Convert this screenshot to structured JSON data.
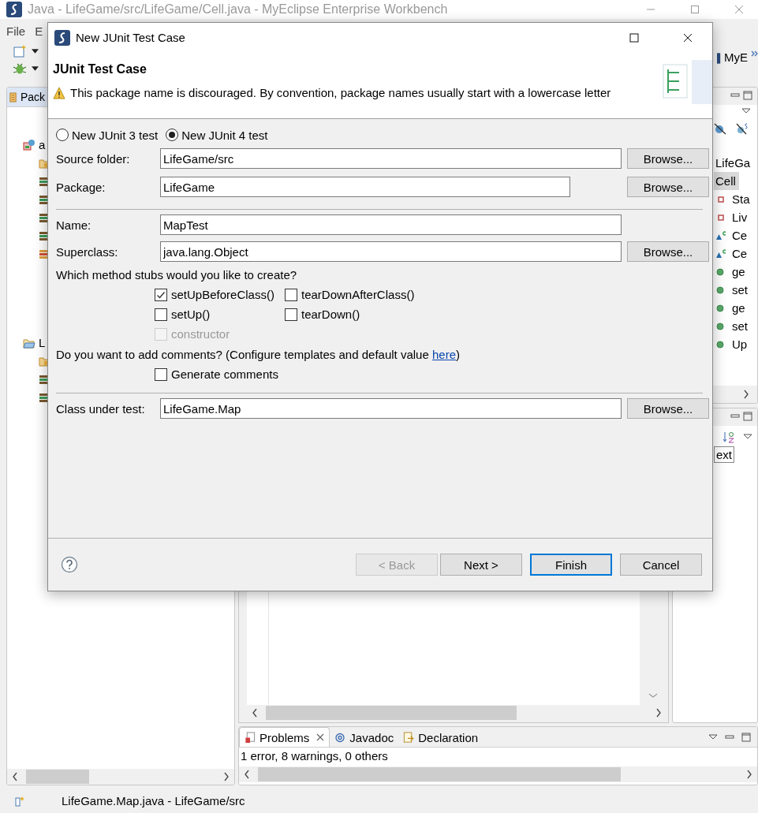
{
  "window": {
    "title": "Java - LifeGame/src/LifeGame/Cell.java - MyEclipse Enterprise Workbench"
  },
  "menu_bar": [
    {
      "label": "File"
    },
    {
      "label": "E"
    }
  ],
  "perspective": {
    "label": "MyE"
  },
  "package_explorer": {
    "tab": "Pack",
    "tree": [
      {
        "label": "a",
        "kind": "project",
        "children": [
          {
            "kind": "package"
          },
          {
            "kind": "library"
          },
          {
            "kind": "library"
          },
          {
            "kind": "library"
          },
          {
            "kind": "library"
          },
          {
            "kind": "error-library"
          }
        ]
      },
      {
        "label": "L",
        "kind": "open-project",
        "children": [
          {
            "kind": "package"
          },
          {
            "kind": "library"
          },
          {
            "kind": "library"
          }
        ]
      }
    ]
  },
  "outline": {
    "items": [
      {
        "label": "LifeGa",
        "selected": false,
        "children": [
          {
            "label": "Cell",
            "selected": true,
            "children": [
              {
                "label": "Sta",
                "kind": "field",
                "selected": false
              },
              {
                "label": "Liv",
                "kind": "field",
                "selected": false
              },
              {
                "label": "Ce",
                "kind": "constructor",
                "selected": false
              },
              {
                "label": "Ce",
                "kind": "constructor",
                "selected": false
              },
              {
                "label": "ge",
                "kind": "method",
                "selected": false
              },
              {
                "label": "set",
                "kind": "method",
                "selected": false
              },
              {
                "label": "ge",
                "kind": "method",
                "selected": false
              },
              {
                "label": "set",
                "kind": "method",
                "selected": false
              },
              {
                "label": "Up",
                "kind": "method",
                "selected": false
              }
            ]
          }
        ]
      }
    ]
  },
  "lower_right_panel": {
    "field_value": "ext"
  },
  "problems": {
    "tabs": [
      {
        "label": "Problems",
        "kind": "problems",
        "selected": true
      },
      {
        "label": "Javadoc",
        "kind": "javadoc",
        "selected": false
      },
      {
        "label": "Declaration",
        "kind": "declaration",
        "selected": false
      }
    ],
    "summary": "1 error, 8 warnings, 0 others"
  },
  "status_bar": {
    "text": "LifeGame.Map.java - LifeGame/src"
  },
  "dialog": {
    "title": "New JUnit Test Case",
    "heading": "JUnit Test Case",
    "message": {
      "kind": "warning",
      "text": "This package name is discouraged. By convention, package names usually start with a lowercase letter"
    },
    "test_versions": [
      {
        "label": "New JUnit 3 test",
        "selected": false
      },
      {
        "label": "New JUnit 4 test",
        "selected": true
      }
    ],
    "source_folder": {
      "label": "Source folder:",
      "value": "LifeGame/src",
      "button": "Browse..."
    },
    "package": {
      "label": "Package:",
      "value": "LifeGame",
      "button": "Browse..."
    },
    "name": {
      "label": "Name:",
      "value": "MapTest"
    },
    "superclass": {
      "label": "Superclass:",
      "value": "java.lang.Object",
      "button": "Browse..."
    },
    "stubs_prompt": "Which method stubs would you like to create?",
    "stubs": [
      {
        "label": "setUpBeforeClass()",
        "checked": true,
        "disabled": false
      },
      {
        "label": "tearDownAfterClass()",
        "checked": false,
        "disabled": false
      },
      {
        "label": "setUp()",
        "checked": false,
        "disabled": false
      },
      {
        "label": "tearDown()",
        "checked": false,
        "disabled": false
      },
      {
        "label": "constructor",
        "checked": false,
        "disabled": true
      }
    ],
    "comments_prompt": {
      "text": "Do you want to add comments? (Configure templates and default value ",
      "link": "here",
      "end": ")"
    },
    "generate_comments": {
      "label": "Generate comments",
      "checked": false,
      "disabled": false
    },
    "class_under_test": {
      "label": "Class under test:",
      "value": "LifeGame.Map",
      "button": "Browse..."
    },
    "buttons": [
      {
        "label": "< Back",
        "disabled": true,
        "default": false
      },
      {
        "label": "Next >",
        "disabled": false,
        "default": false
      },
      {
        "label": "Finish",
        "disabled": false,
        "default": true
      },
      {
        "label": "Cancel",
        "disabled": false,
        "default": false
      }
    ]
  }
}
